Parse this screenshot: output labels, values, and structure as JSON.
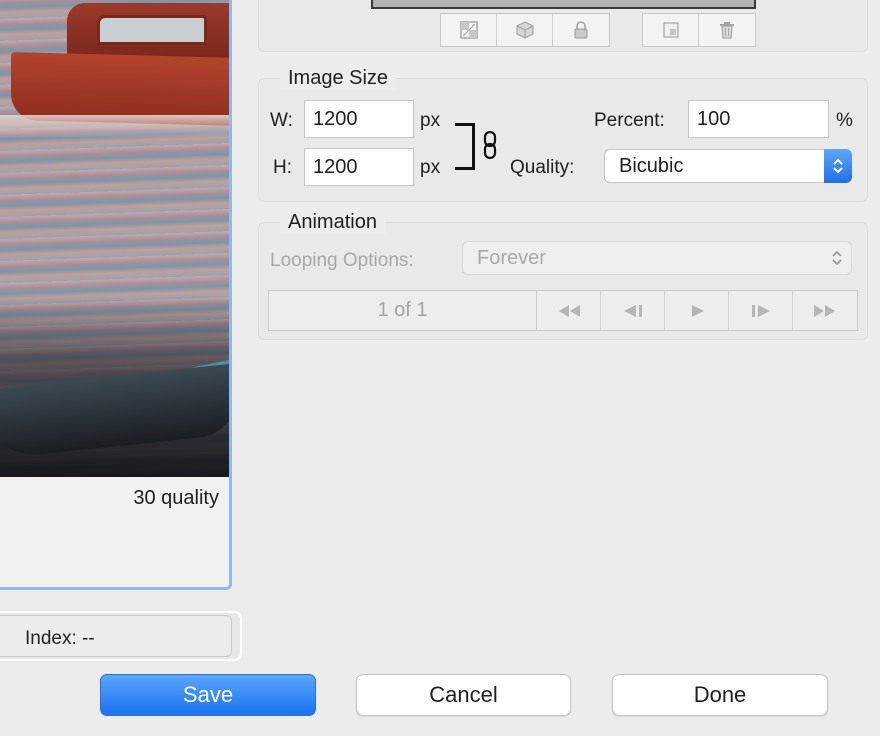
{
  "preview": {
    "caption": "30 quality",
    "index_label": "Index: --"
  },
  "toolbar_icons": {
    "group1": [
      "transparency-icon",
      "web-cube-icon",
      "lock-icon"
    ],
    "group2": [
      "new-color-icon",
      "trash-icon"
    ]
  },
  "image_size": {
    "title": "Image Size",
    "width_label": "W:",
    "width_value": "1200",
    "width_unit": "px",
    "height_label": "H:",
    "height_value": "1200",
    "height_unit": "px",
    "percent_label": "Percent:",
    "percent_value": "100",
    "percent_unit": "%",
    "quality_label": "Quality:",
    "quality_value": "Bicubic"
  },
  "animation": {
    "title": "Animation",
    "looping_label": "Looping Options:",
    "looping_value": "Forever",
    "frame_counter": "1 of 1"
  },
  "buttons": {
    "save": "Save",
    "cancel": "Cancel",
    "done": "Done"
  },
  "colors": {
    "accent": "#1b72f0",
    "selection_border": "#8fb7f0"
  }
}
